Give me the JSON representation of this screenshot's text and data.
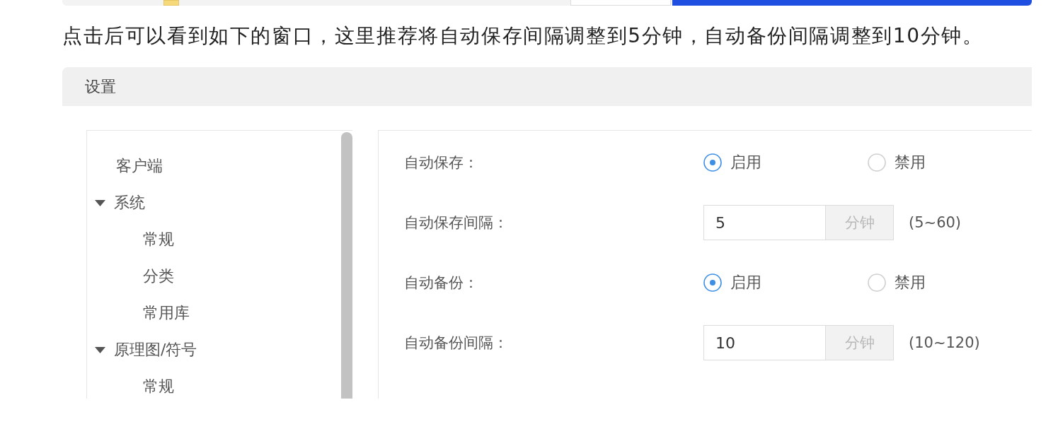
{
  "intro_text": "点击后可以看到如下的窗口，这里推荐将自动保存间隔调整到5分钟，自动备份间隔调整到10分钟。",
  "dialog": {
    "title": "设置",
    "tree": [
      {
        "label": "客户端"
      },
      {
        "label": "系统",
        "expanded": true,
        "children": [
          {
            "label": "常规"
          },
          {
            "label": "分类"
          },
          {
            "label": "常用库"
          }
        ]
      },
      {
        "label": "原理图/符号",
        "expanded": true,
        "children": [
          {
            "label": "常规"
          }
        ]
      }
    ],
    "settings": [
      {
        "kind": "radio",
        "label": "自动保存：",
        "options": [
          {
            "label": "启用",
            "selected": true
          },
          {
            "label": "禁用",
            "selected": false
          }
        ]
      },
      {
        "kind": "number",
        "label": "自动保存间隔：",
        "value": "5",
        "unit": "分钟",
        "range": "(5~60)"
      },
      {
        "kind": "radio",
        "label": "自动备份：",
        "options": [
          {
            "label": "启用",
            "selected": true
          },
          {
            "label": "禁用",
            "selected": false
          }
        ]
      },
      {
        "kind": "number",
        "label": "自动备份间隔：",
        "value": "10",
        "unit": "分钟",
        "range": "(10~120)"
      }
    ]
  }
}
